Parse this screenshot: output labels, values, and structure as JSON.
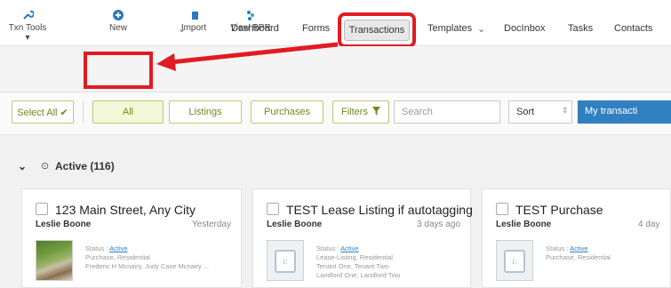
{
  "nav": {
    "items": [
      "Dashboard",
      "Forms",
      "Transactions",
      "Templates",
      "DocInbox",
      "Tasks",
      "Contacts"
    ],
    "active": "Transactions",
    "chevron": "⌄",
    "templates_chevron": "⌄"
  },
  "toolbar": {
    "txn_tools_label": "Txn Tools ▾",
    "new_label": "New",
    "import_label": "Import",
    "view_rpr_label": "View RPR"
  },
  "filters": {
    "select_all_label": "Select All ✔",
    "all_label": "All",
    "listings_label": "Listings",
    "purchases_label": "Purchases",
    "filters_label": "Filters",
    "search_placeholder": "Search",
    "sort_label": "Sort",
    "my_transactions_label": "My transacti"
  },
  "section": {
    "title": "Active (116)"
  },
  "cards": [
    {
      "title": "123 Main Street, Any City",
      "owner": "Leslie Boone",
      "date": "Yesterday",
      "status_prefix": "Status : ",
      "status": "Active",
      "type": "Purchase, Residential",
      "parties": [
        "Frederic H Mcnairy, Judy Case Mcnairy ..."
      ]
    },
    {
      "title": "TEST Lease Listing if autotagging",
      "owner": "Leslie Boone",
      "date": "3 days ago",
      "status_prefix": "Status : ",
      "status": "Active",
      "type": "Lease-Listing, Residential",
      "parties": [
        "Tenant One, Tenant Two",
        "Landlord One, Landlord Two"
      ]
    },
    {
      "title": "TEST Purchase",
      "owner": "Leslie Boone",
      "date": "4 day",
      "status_prefix": "Status : ",
      "status": "Active",
      "type": "Purchase, Residential",
      "parties": []
    }
  ],
  "colors": {
    "accent": "#2f7fc1",
    "highlight": "#e11b22",
    "filter_green": "#6b8c1f"
  },
  "icons": {
    "txn_tools": "wrench-icon",
    "new": "plus-circle-icon",
    "import": "import-icon",
    "view_rpr": "rpr-icon",
    "filters": "funnel-icon",
    "section_toggle": "chevron-down-icon",
    "section_clock": "clock-icon"
  }
}
